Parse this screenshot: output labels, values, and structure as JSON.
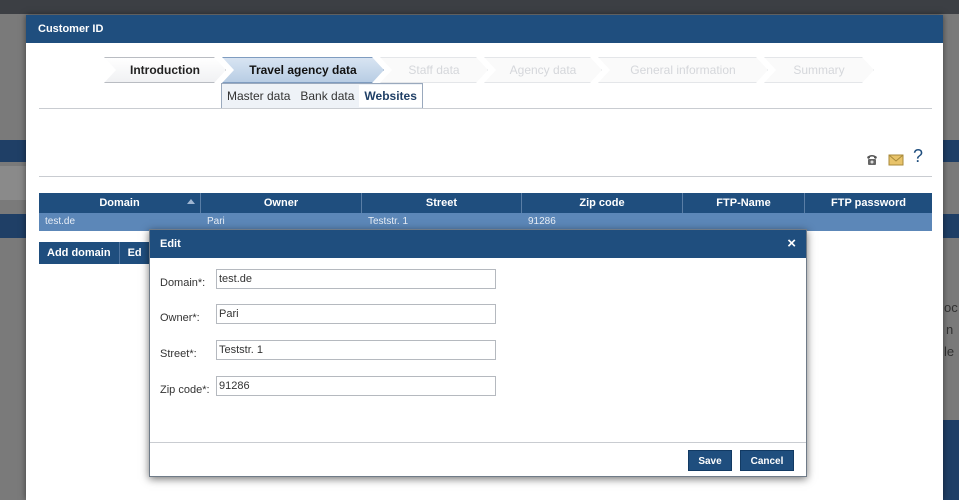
{
  "window": {
    "title": "Customer ID"
  },
  "wizard": {
    "steps": [
      {
        "label": "Introduction",
        "state": "done"
      },
      {
        "label": "Travel agency data",
        "state": "active"
      },
      {
        "label": "Staff data",
        "state": "disabled"
      },
      {
        "label": "Agency data",
        "state": "disabled"
      },
      {
        "label": "General information",
        "state": "disabled"
      },
      {
        "label": "Summary",
        "state": "disabled"
      }
    ]
  },
  "subtabs": [
    {
      "label": "Master data"
    },
    {
      "label": "Bank data"
    },
    {
      "label": "Websites"
    }
  ],
  "icons": {
    "help_label": "?"
  },
  "grid": {
    "columns": [
      "Domain",
      "Owner",
      "Street",
      "Zip code",
      "FTP-Name",
      "FTP password"
    ],
    "rows": [
      [
        "test.de",
        "Pari",
        "Teststr. 1",
        "91286",
        "",
        ""
      ]
    ]
  },
  "toolbar": {
    "add_label": "Add domain",
    "edit_label": "Ed"
  },
  "modal": {
    "title": "Edit",
    "close_label": "×",
    "fields": [
      {
        "label": "Domain*:",
        "value": "test.de"
      },
      {
        "label": "Owner*:",
        "value": "Pari"
      },
      {
        "label": "Street*:",
        "value": "Teststr. 1"
      },
      {
        "label": "Zip code*:",
        "value": "91286"
      }
    ],
    "save_label": "Save",
    "cancel_label": "Cancel"
  },
  "background": {
    "text_fragments": [
      "oc",
      "n",
      "le"
    ]
  },
  "colors": {
    "header": "#1f4e7e",
    "selected_row": "#5c87b8"
  }
}
